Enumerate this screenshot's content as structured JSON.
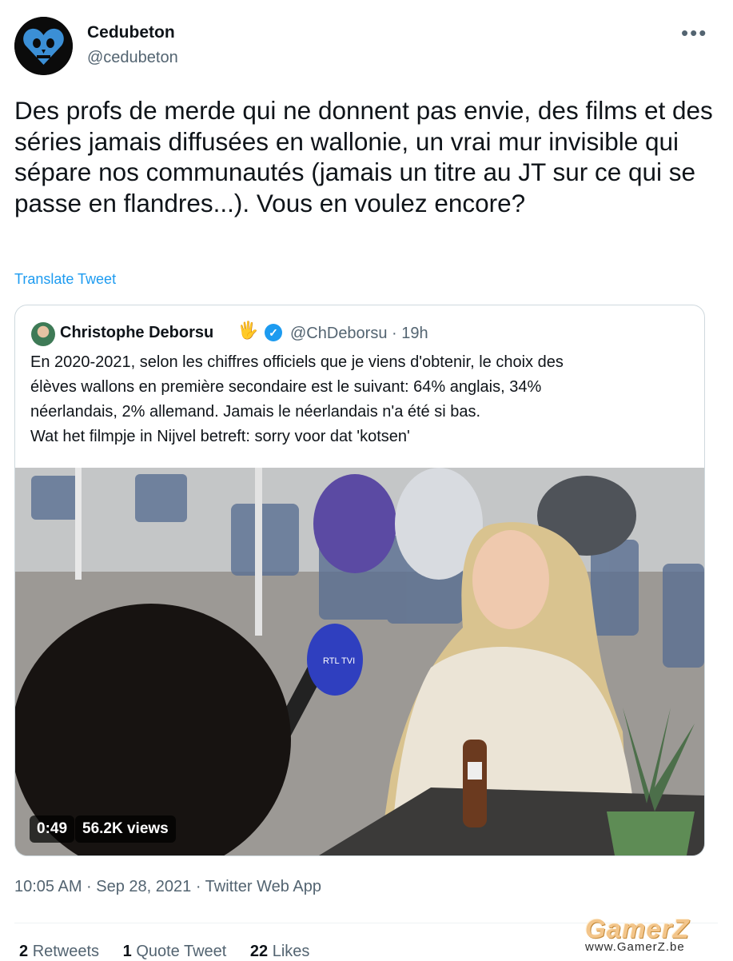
{
  "tweet": {
    "author": {
      "display_name": "Cedubeton",
      "handle": "@cedubeton"
    },
    "more_icon": "more-horizontal-icon",
    "text": "Des profs de merde qui ne donnent pas envie, des films et des séries jamais diffusées en wallonie, un vrai mur invisible qui sépare nos communautés (jamais un titre au JT sur ce qui se passe en flandres...). Vous en voulez encore?",
    "translate_label": "Translate Tweet",
    "meta": "10:05 AM · Sep 28, 2021 · Twitter Web App",
    "stats": {
      "retweets_count": "2",
      "retweets_label": "Retweets",
      "quotes_count": "1",
      "quotes_label": "Quote Tweet",
      "likes_count": "22",
      "likes_label": "Likes"
    }
  },
  "quote": {
    "display_name": "Christophe Deborsu",
    "emoji": "🖐",
    "verified_icon": "verified-badge-icon",
    "handle_time": "@ChDeborsu · 19h",
    "lines": [
      "En 2020-2021, selon les chiffres officiels que je viens d'obtenir, le choix des",
      "élèves wallons en première secondaire est le suivant: 64% anglais, 34%",
      "néerlandais, 2% allemand. Jamais le néerlandais n'a été si bas.",
      "Wat het filmpje in Nijvel betreft: sorry voor dat 'kotsen'"
    ],
    "video": {
      "duration": "0:49",
      "views": "56.2K views",
      "mic_logo": "RTL TVI"
    }
  },
  "watermark": {
    "logo": "GamerZ",
    "url": "www.GamerZ.be"
  },
  "colors": {
    "link_blue": "#1d9bf0",
    "text_primary": "#0f1419",
    "text_secondary": "#536471",
    "border": "#cfd9de"
  }
}
